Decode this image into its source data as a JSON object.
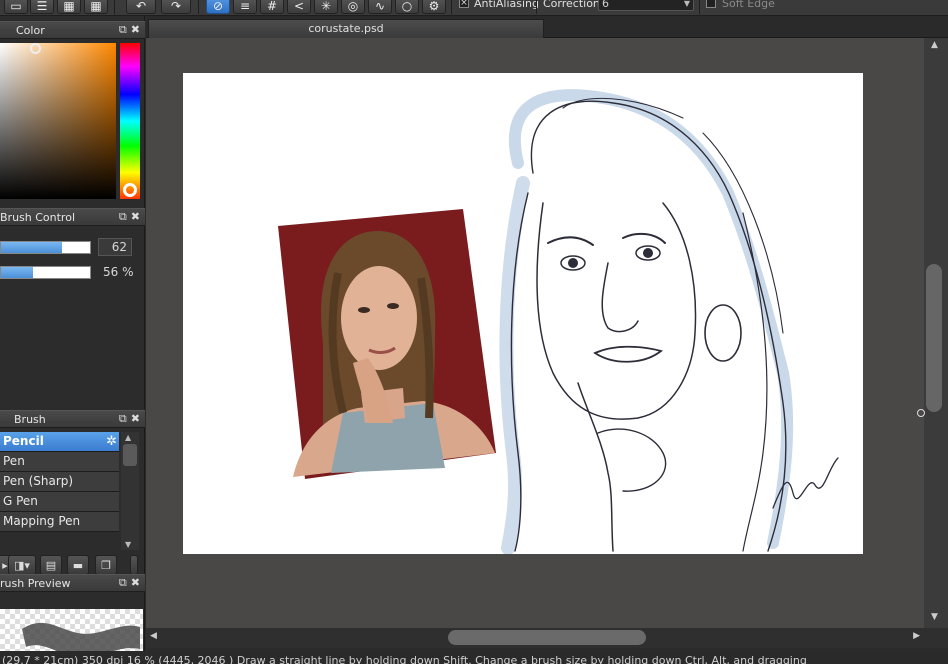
{
  "toolbar": {
    "antialiasing_label": "AntiAliasing",
    "correction_label": "Correction",
    "correction_value": "6",
    "soft_edge_label": "Soft Edge"
  },
  "color_panel": {
    "title": "Color"
  },
  "brush_control": {
    "title": "Brush Control",
    "size_value": "62",
    "size_fraction": 0.69,
    "density_value": "56 %",
    "density_fraction": 0.36
  },
  "brush_panel": {
    "title": "Brush",
    "items": [
      {
        "label": "Pencil"
      },
      {
        "label": "Pen"
      },
      {
        "label": "Pen (Sharp)"
      },
      {
        "label": "G Pen"
      },
      {
        "label": "Mapping Pen"
      }
    ]
  },
  "brush_preview": {
    "title": "rush Preview"
  },
  "document": {
    "tab_title": "corustate.psd"
  },
  "status_bar": {
    "text": "(29.7 * 21cm)  350 dpi  16 %  (4445, 2046 )  Draw a straight line by holding down Shift. Change a brush size by holding down Ctrl, Alt, and dragging"
  },
  "colors": {
    "accent": "#4b8fd6",
    "workspace": "#4a4747",
    "backdrop": "#7a1c1e"
  }
}
